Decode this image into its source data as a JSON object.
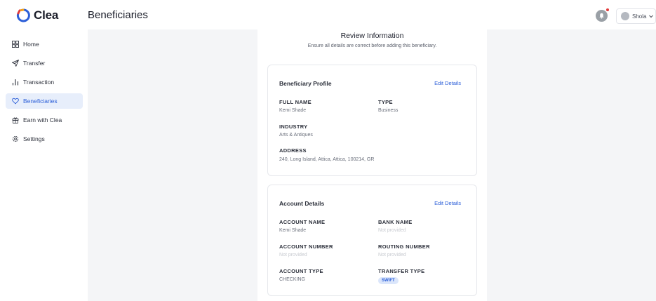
{
  "app": {
    "name": "Clea"
  },
  "header": {
    "title": "Beneficiaries",
    "user_name": "Shola"
  },
  "sidebar": {
    "items": [
      {
        "label": "Home",
        "icon": "grid-icon"
      },
      {
        "label": "Transfer",
        "icon": "send-icon"
      },
      {
        "label": "Transaction",
        "icon": "bar-chart-icon"
      },
      {
        "label": "Beneficiaries",
        "icon": "heart-icon",
        "active": true
      },
      {
        "label": "Earn with Clea",
        "icon": "gift-icon"
      },
      {
        "label": "Settings",
        "icon": "gear-icon"
      }
    ]
  },
  "review": {
    "title": "Review Information",
    "subtitle": "Ensure all details are correct before adding this beneficiary."
  },
  "profile": {
    "title": "Beneficiary Profile",
    "edit_label": "Edit Details",
    "full_name_label": "FULL NAME",
    "full_name": "Kemi Shade",
    "type_label": "TYPE",
    "type": "Business",
    "industry_label": "INDUSTRY",
    "industry": "Arts & Antiques",
    "address_label": "ADDRESS",
    "address": "240, Long Island, Attica, Attica, 100214, GR"
  },
  "account": {
    "title": "Account Details",
    "edit_label": "Edit Details",
    "account_name_label": "ACCOUNT NAME",
    "account_name": "Kemi Shade",
    "bank_name_label": "BANK NAME",
    "bank_name": "Not provided",
    "account_number_label": "ACCOUNT NUMBER",
    "account_number": "Not provided",
    "routing_number_label": "ROUTING NUMBER",
    "routing_number": "Not provided",
    "account_type_label": "ACCOUNT TYPE",
    "account_type": "CHECKING",
    "transfer_type_label": "TRANSFER TYPE",
    "transfer_type": "SWIFT"
  },
  "colors": {
    "accent": "#2c5fd8",
    "active_bg": "#e7eefb",
    "content_bg": "#f4f5f7"
  }
}
